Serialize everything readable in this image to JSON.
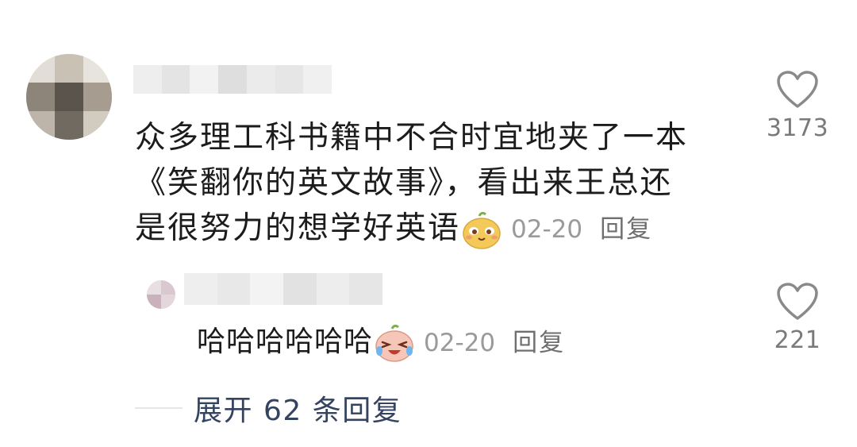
{
  "comment": {
    "avatar": "user-avatar-pixelated",
    "username": "",
    "text_lines": [
      "众多理工科书籍中不合时宜地夹了一本",
      "《笑翻你的英文故事》，看出来王总还",
      "是很努力的想学好英语"
    ],
    "emoji": "smug-face-emoji",
    "date": "02-20",
    "reply_label": "回复",
    "like_icon": "heart-outline-icon",
    "like_count": "3173"
  },
  "reply": {
    "avatar": "user-avatar-pixelated",
    "username": "",
    "text": "哈哈哈哈哈哈",
    "emoji": "laughing-crying-face-emoji",
    "date": "02-20",
    "reply_label": "回复",
    "like_icon": "heart-outline-icon",
    "like_count": "221"
  },
  "expand": {
    "label": "展开 62 条回复"
  },
  "colors": {
    "text": "#1c1c1c",
    "meta_date": "#9a9a9a",
    "meta_reply": "#6f6f6f",
    "like_count": "#7a7a7a",
    "expand_link": "#34435f",
    "emoji_yellow": "#f3c95a"
  }
}
